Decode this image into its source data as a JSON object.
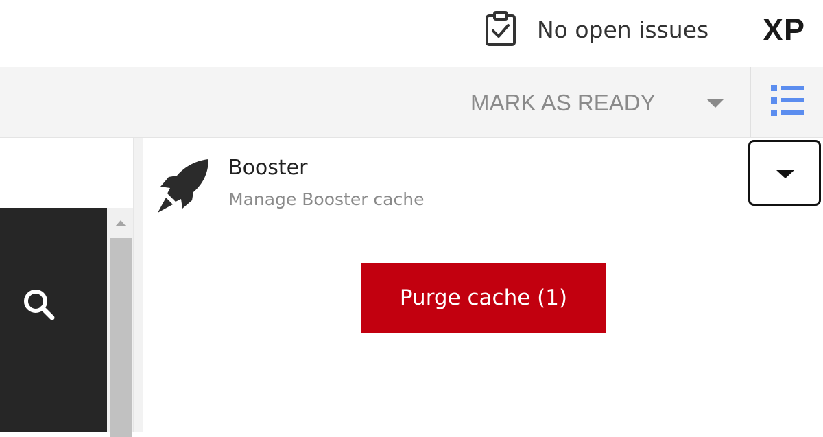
{
  "header": {
    "issues_icon": "clipboard-check-icon",
    "issues_text": "No open issues",
    "logo": "XP"
  },
  "toolbar": {
    "mark_ready_label": "MARK AS READY",
    "list_toggle_icon": "list-icon",
    "accent_color": "#5b8def"
  },
  "left_panel": {
    "search_icon": "search-icon"
  },
  "widget": {
    "icon": "rocket-icon",
    "title": "Booster",
    "subtitle": "Manage Booster cache",
    "dropdown_icon": "caret-down-icon",
    "purge_label": "Purge cache (1)",
    "purge_color": "#c2000f"
  }
}
